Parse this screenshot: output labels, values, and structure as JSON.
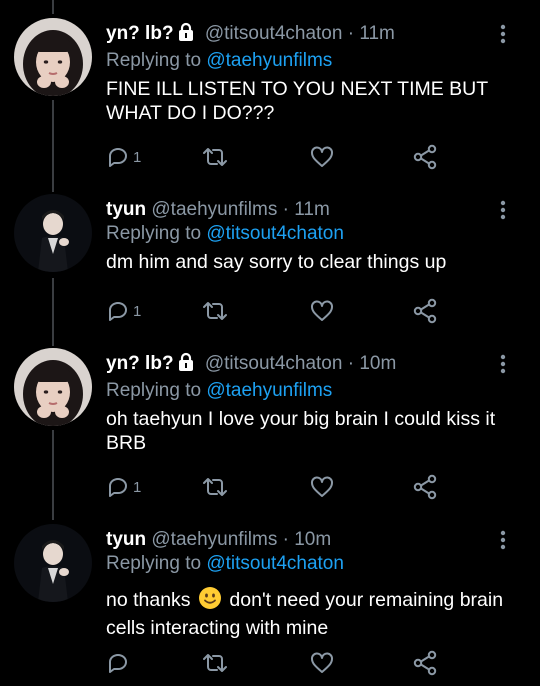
{
  "tweets": [
    {
      "author": {
        "name": "yn? lb?",
        "handle": "@titsout4chaton",
        "locked": true,
        "avatar": "girl-avatar"
      },
      "time": "11m",
      "replying_prefix": "Replying to",
      "replying_to": "@taehyunfilms",
      "text": "FINE ILL LISTEN TO YOU NEXT TIME BUT WHAT DO I DO???",
      "reply_count": "1"
    },
    {
      "author": {
        "name": "tyun",
        "handle": "@taehyunfilms",
        "locked": false,
        "avatar": "boy-avatar"
      },
      "time": "11m",
      "replying_prefix": "Replying to",
      "replying_to": "@titsout4chaton",
      "text": "dm him and say sorry to clear things up",
      "reply_count": "1"
    },
    {
      "author": {
        "name": "yn? lb?",
        "handle": "@titsout4chaton",
        "locked": true,
        "avatar": "girl-avatar"
      },
      "time": "10m",
      "replying_prefix": "Replying to",
      "replying_to": "@taehyunfilms",
      "text": "oh taehyun I love your big brain I could kiss it BRB",
      "reply_count": "1"
    },
    {
      "author": {
        "name": "tyun",
        "handle": "@taehyunfilms",
        "locked": false,
        "avatar": "boy-avatar"
      },
      "time": "10m",
      "replying_prefix": "Replying to",
      "replying_to": "@titsout4chaton",
      "text_before_emoji": "no thanks",
      "text_after_emoji": "don't need your remaining brain cells interacting with mine",
      "emoji": "slightly-smiling-face",
      "reply_count": ""
    }
  ],
  "separator": "·",
  "colors": {
    "background": "#000000",
    "text": "#ffffff",
    "secondary": "#8b98a5",
    "accent": "#1da1f2",
    "thread_line": "#3a3d41"
  }
}
